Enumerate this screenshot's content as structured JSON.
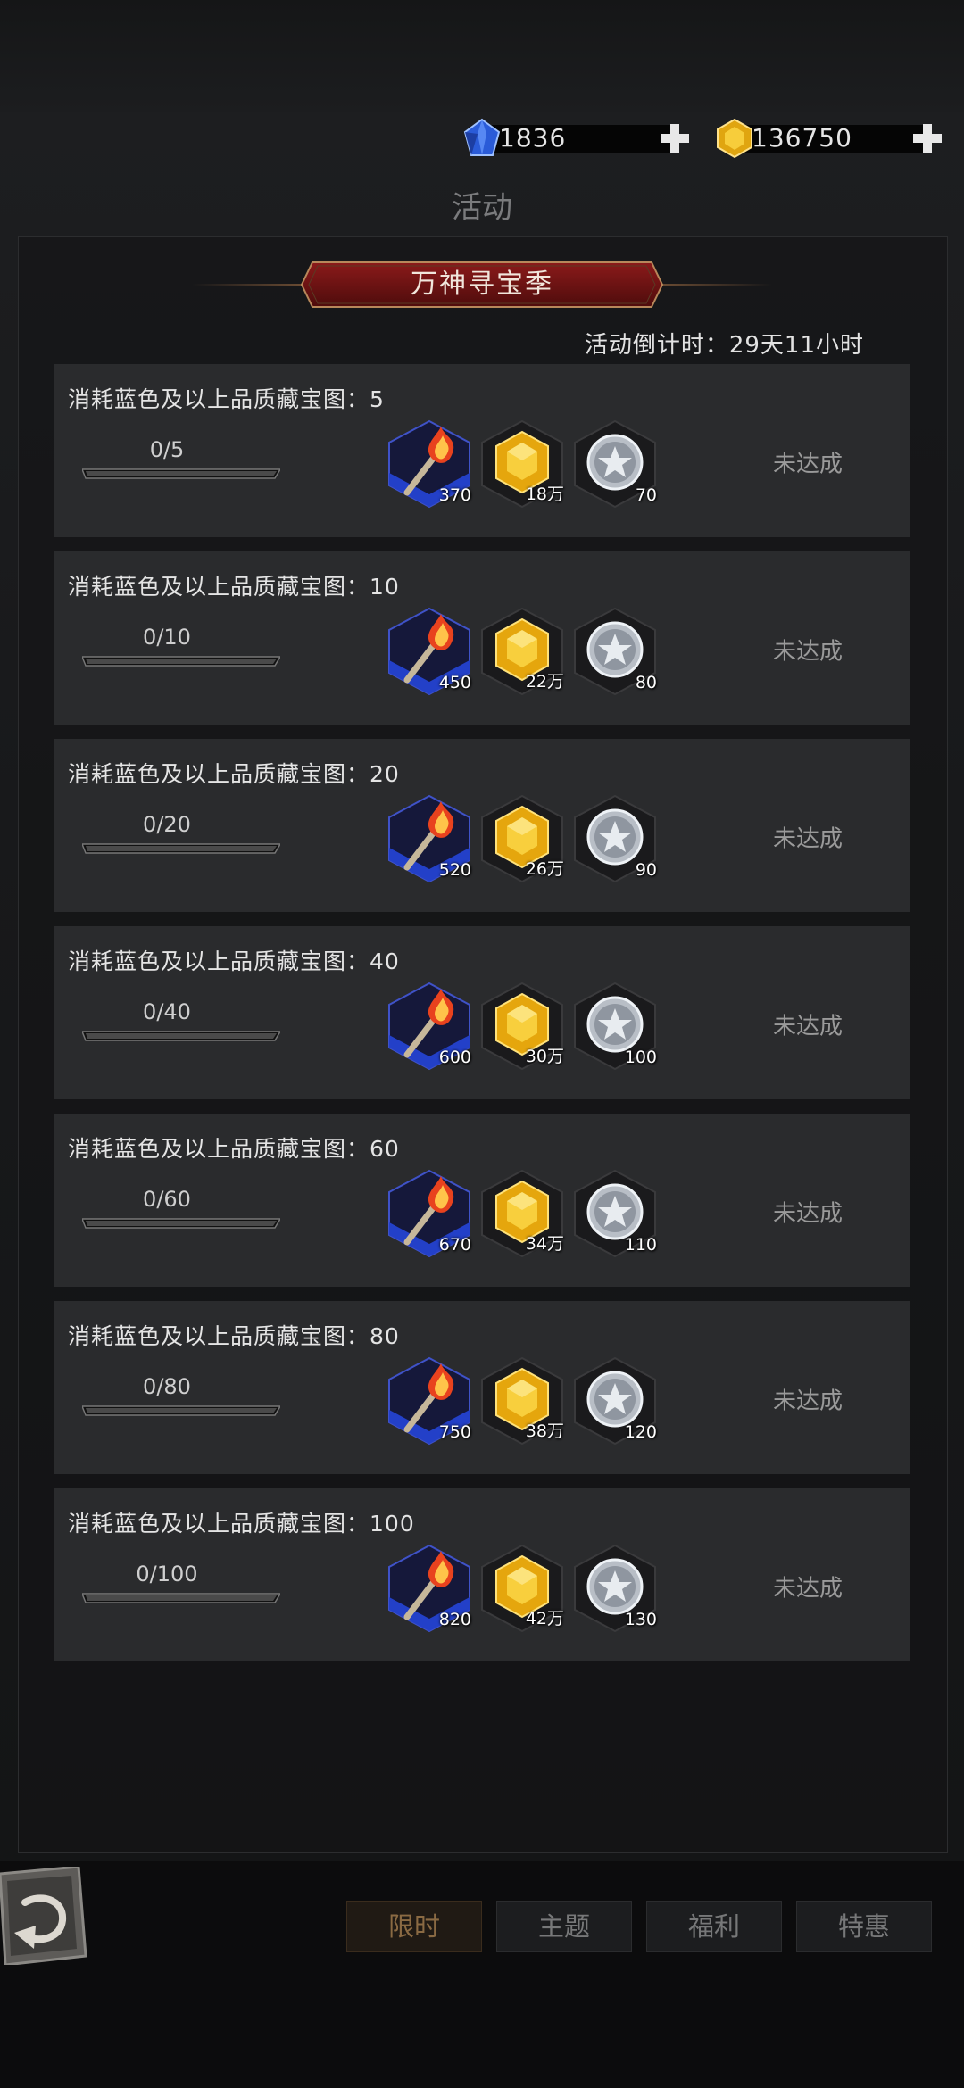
{
  "header": {
    "gems": "1836",
    "gold": "136750",
    "page_title": "活动"
  },
  "event": {
    "name": "万神寻宝季",
    "countdown": "活动倒计时：29天11小时"
  },
  "tasks": [
    {
      "title": "消耗蓝色及以上品质藏宝图：5",
      "progress": "0/5",
      "rewards": [
        "370",
        "18万",
        "70"
      ],
      "status": "未达成",
      "fill": 0
    },
    {
      "title": "消耗蓝色及以上品质藏宝图：10",
      "progress": "0/10",
      "rewards": [
        "450",
        "22万",
        "80"
      ],
      "status": "未达成",
      "fill": 0
    },
    {
      "title": "消耗蓝色及以上品质藏宝图：20",
      "progress": "0/20",
      "rewards": [
        "520",
        "26万",
        "90"
      ],
      "status": "未达成",
      "fill": 0
    },
    {
      "title": "消耗蓝色及以上品质藏宝图：40",
      "progress": "0/40",
      "rewards": [
        "600",
        "30万",
        "100"
      ],
      "status": "未达成",
      "fill": 0
    },
    {
      "title": "消耗蓝色及以上品质藏宝图：60",
      "progress": "0/60",
      "rewards": [
        "670",
        "34万",
        "110"
      ],
      "status": "未达成",
      "fill": 0
    },
    {
      "title": "消耗蓝色及以上品质藏宝图：80",
      "progress": "0/80",
      "rewards": [
        "750",
        "38万",
        "120"
      ],
      "status": "未达成",
      "fill": 0
    },
    {
      "title": "消耗蓝色及以上品质藏宝图：100",
      "progress": "0/100",
      "rewards": [
        "820",
        "42万",
        "130"
      ],
      "status": "未达成",
      "fill": 0
    }
  ],
  "reward_icons": [
    "torch-icon",
    "gold-gem-icon",
    "silver-star-coin-icon"
  ],
  "tabs": [
    "限时",
    "主题",
    "福利",
    "特惠"
  ],
  "active_tab": 0,
  "colors": {
    "accent": "#8a6a43",
    "banner": "#7a1414",
    "status": "#9a9a9a",
    "row_bg": "#2a2b2d"
  }
}
